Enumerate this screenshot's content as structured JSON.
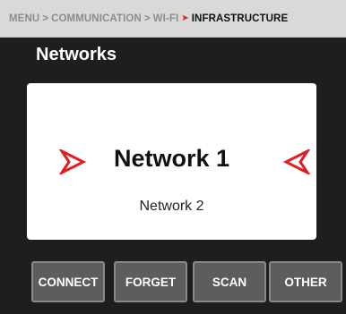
{
  "breadcrumb": {
    "items": [
      "MENU",
      "COMMUNICATION",
      "WI-FI"
    ],
    "separator": ">",
    "current": "INFRASTRUCTURE",
    "current_arrow_color": "#e31b23"
  },
  "page_title": "Networks",
  "network_picker": {
    "selected": "Network 1",
    "next": "Network 2",
    "prev_icon": "right-pointing-arrowhead-icon",
    "next_icon": "left-pointing-arrowhead-icon",
    "arrow_color": "#e31b23"
  },
  "actions": {
    "connect": "CONNECT",
    "forget": "FORGET",
    "scan": "SCAN",
    "other": "OTHER"
  }
}
